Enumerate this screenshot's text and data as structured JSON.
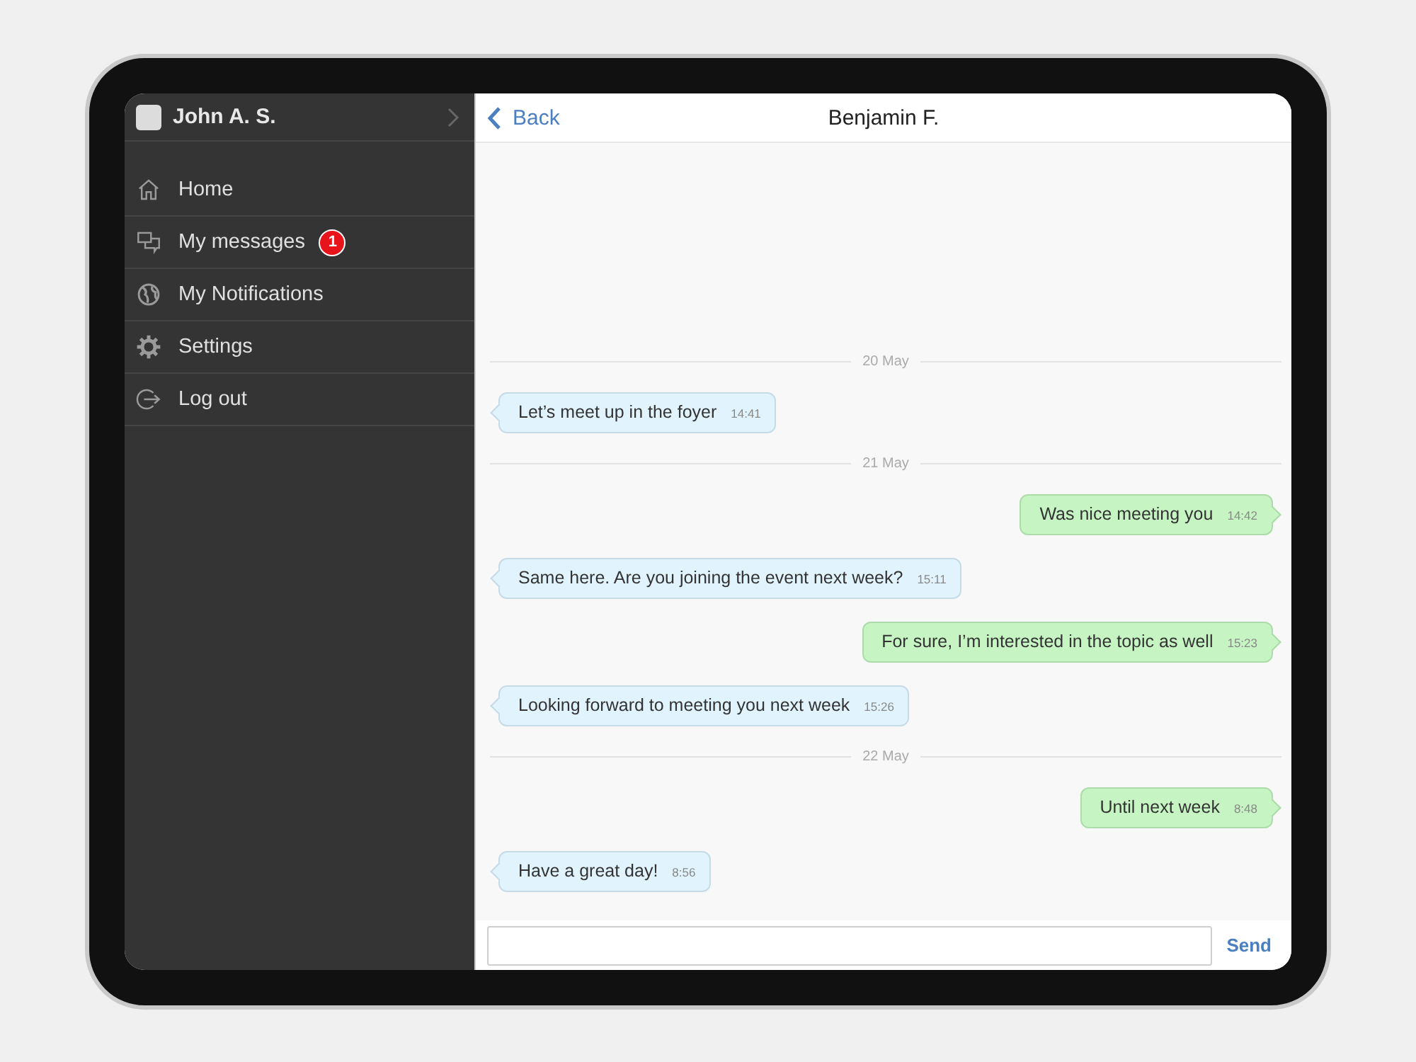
{
  "sidebar": {
    "user": {
      "name": "John A. S."
    },
    "items": [
      {
        "label": "Home"
      },
      {
        "label": "My messages",
        "badge": "1"
      },
      {
        "label": "My Notifications"
      },
      {
        "label": "Settings"
      },
      {
        "label": "Log out"
      }
    ]
  },
  "chat": {
    "back": "Back",
    "title": "Benjamin F.",
    "messages": [
      {
        "kind": "date",
        "text": "20 May"
      },
      {
        "kind": "incoming",
        "text": "Let’s meet up in the foyer",
        "time": "14:41"
      },
      {
        "kind": "date",
        "text": "21 May"
      },
      {
        "kind": "outgoing",
        "text": "Was nice meeting you",
        "time": "14:42"
      },
      {
        "kind": "incoming",
        "text": "Same here. Are you joining the event next week?",
        "time": "15:11"
      },
      {
        "kind": "outgoing",
        "text": "For sure, I’m interested in the topic as well",
        "time": "15:23"
      },
      {
        "kind": "incoming",
        "text": "Looking forward to meeting you next week",
        "time": "15:26"
      },
      {
        "kind": "date",
        "text": "22 May"
      },
      {
        "kind": "outgoing",
        "text": "Until next week",
        "time": "8:48"
      },
      {
        "kind": "incoming",
        "text": "Have a great day!",
        "time": "8:56"
      }
    ],
    "send": "Send"
  }
}
